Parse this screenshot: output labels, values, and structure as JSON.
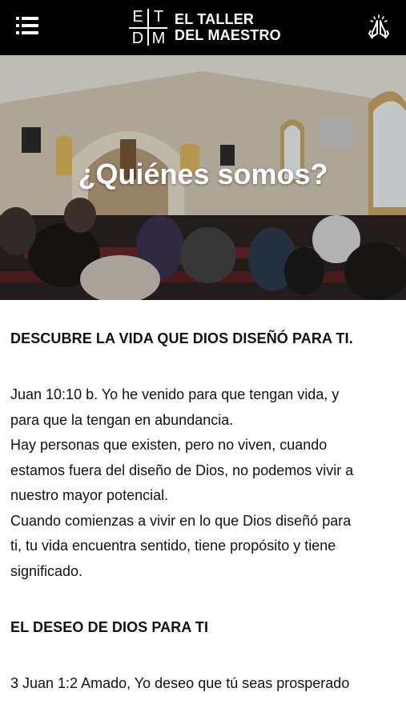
{
  "header": {
    "logo_letters": [
      "E",
      "T",
      "D",
      "M"
    ],
    "logo_line1": "EL TALLER",
    "logo_line2": "DEL MAESTRO",
    "menu_icon": "hamburger-menu-icon",
    "right_icon": "praying-hands-icon"
  },
  "hero": {
    "title": "¿Quiénes somos?"
  },
  "content": {
    "heading1": "DESCUBRE LA VIDA QUE DIOS DISEÑÓ PARA TI.",
    "lines": [
      "Juan 10:10 b. Yo he venido para que tengan vida, y",
      "para que la tengan en abundancia.",
      "Hay personas que existen, pero no viven, cuando",
      "estamos fuera del diseño de Dios, no podemos vivir a",
      "nuestro mayor potencial.",
      "Cuando comienzas a vivir en lo que Dios diseñó para",
      "ti, tu vida encuentra sentido, tiene propósito y tiene",
      "significado."
    ],
    "heading2": "EL DESEO DE DIOS PARA TI",
    "line_last": "3 Juan 1:2 Amado, Yo deseo que tú seas prosperado"
  }
}
